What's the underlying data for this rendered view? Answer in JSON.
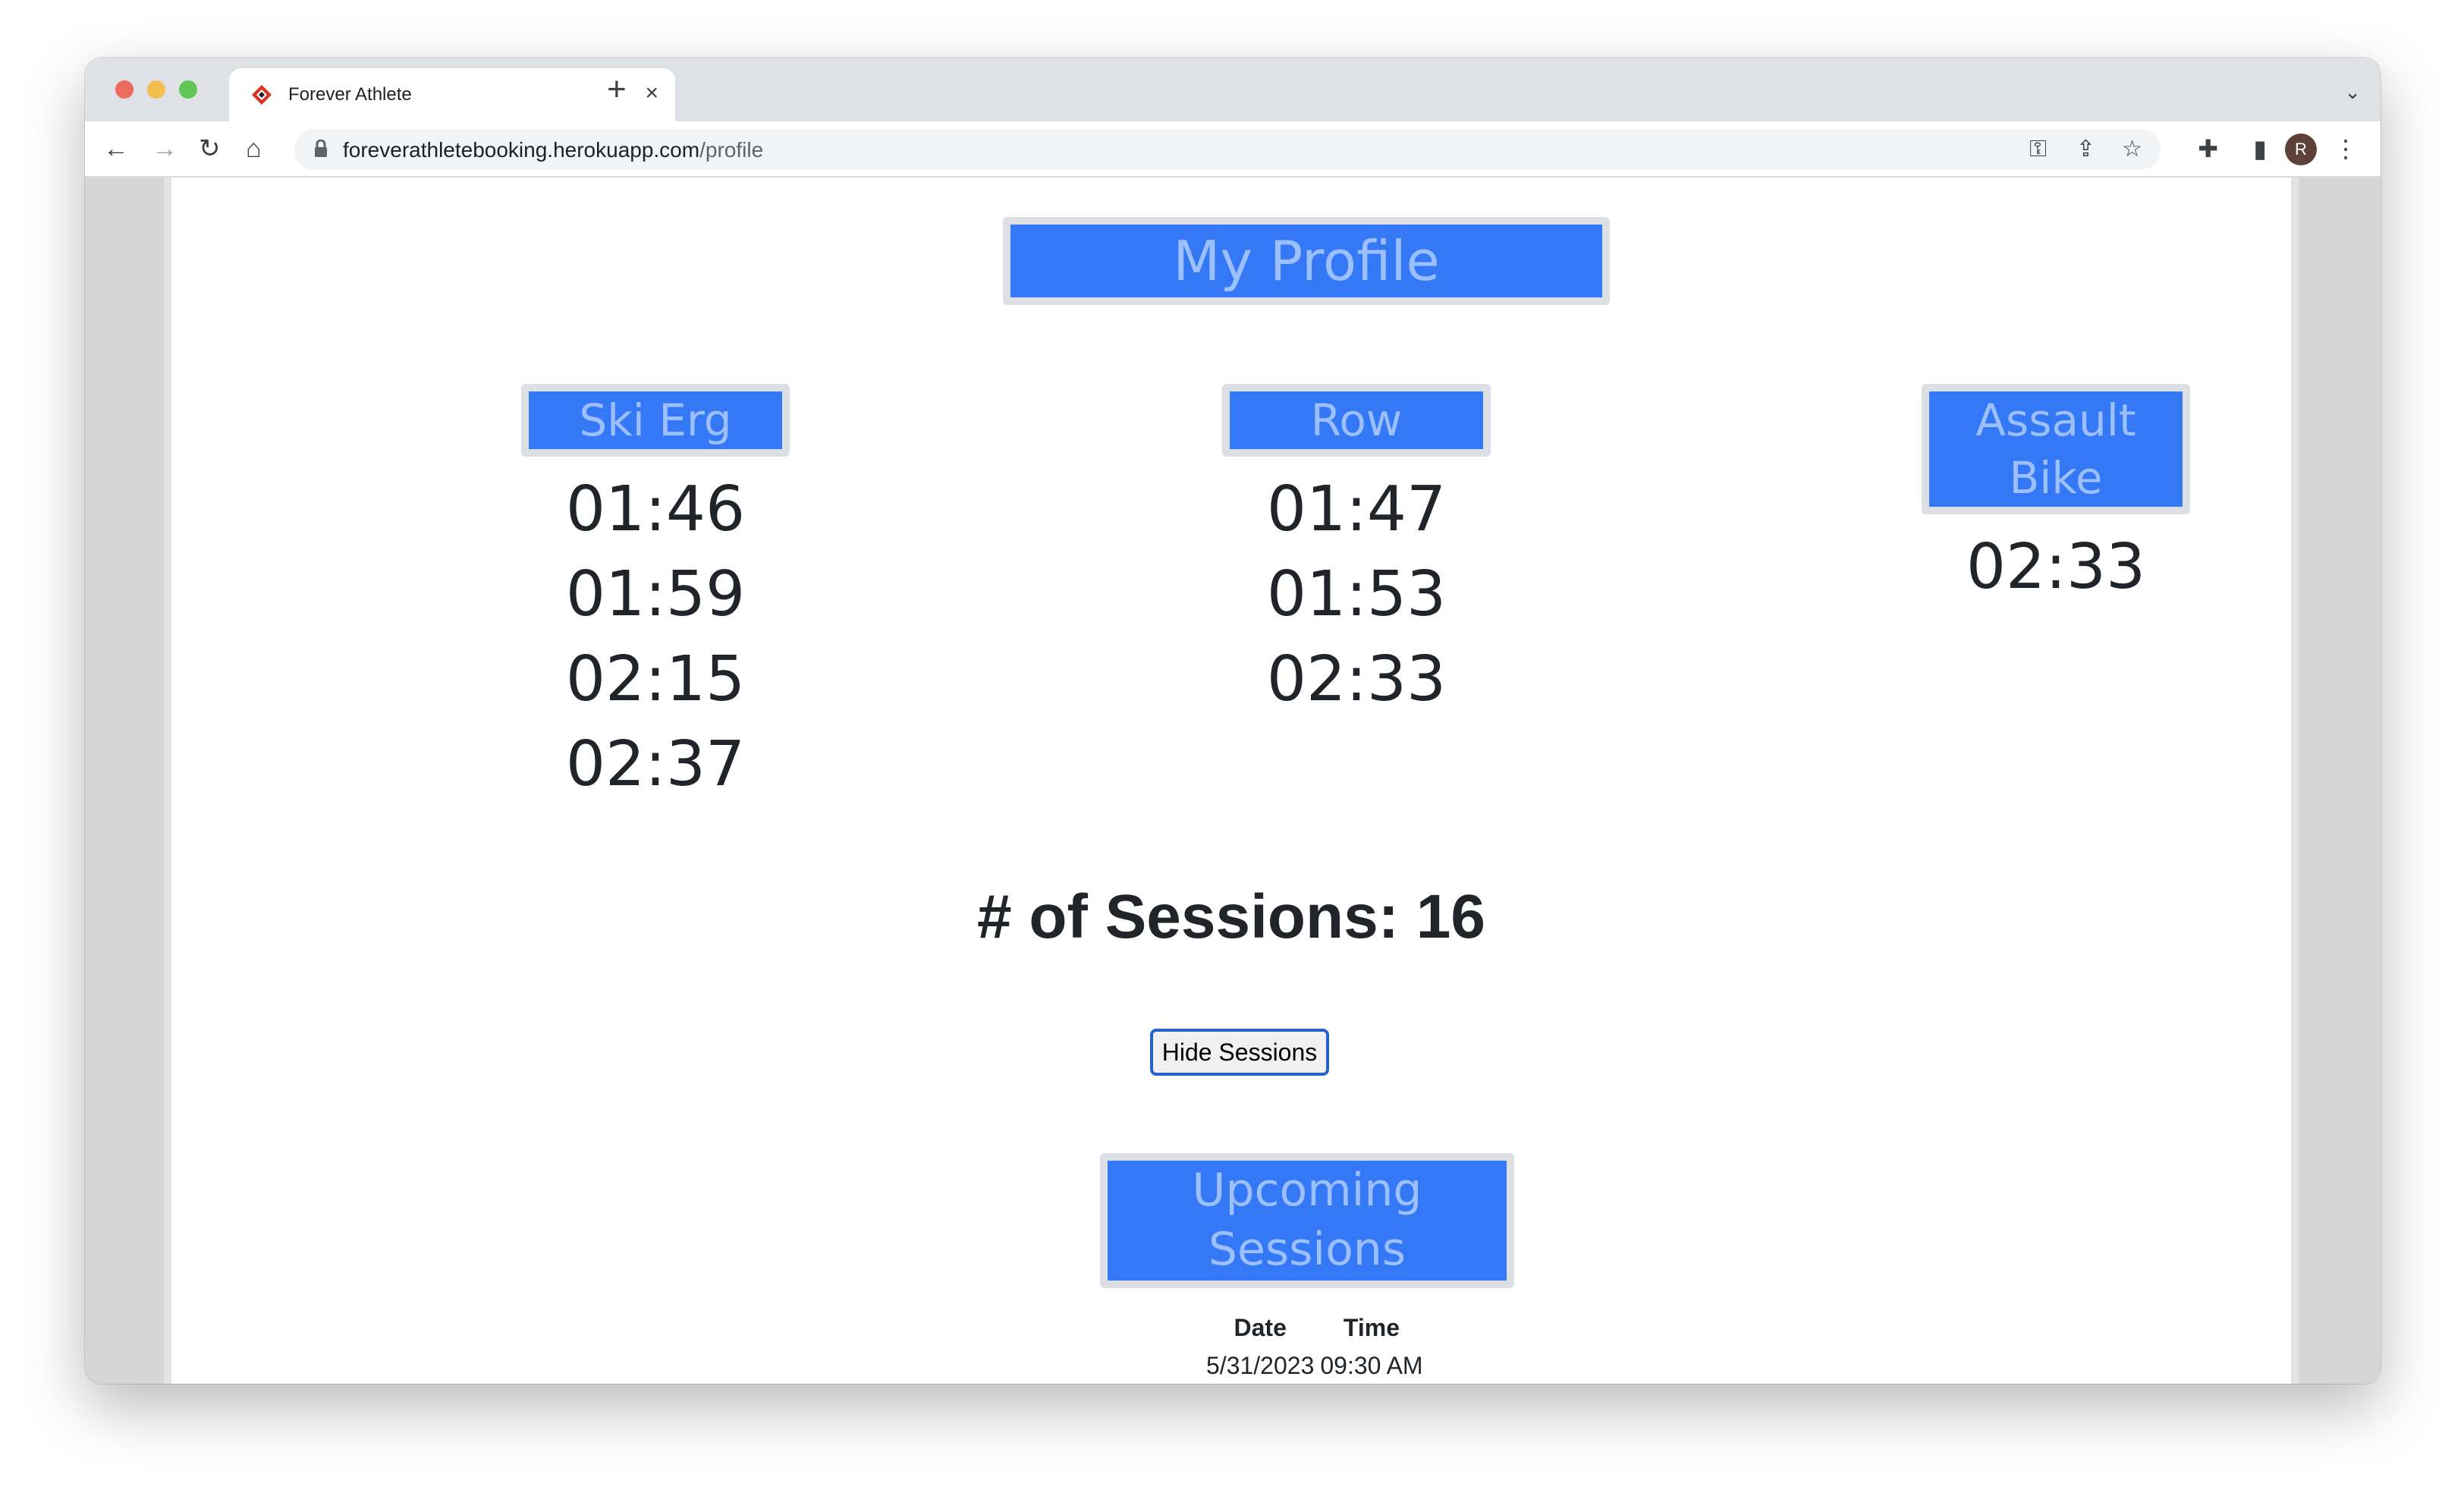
{
  "browser": {
    "tab_title": "Forever Athlete",
    "tab_close": "×",
    "new_tab": "+",
    "tab_menu": "⌄",
    "url_host": "foreverathletebooking.herokuapp.com",
    "url_path": "/profile",
    "avatar_letter": "R",
    "icons": {
      "back": "←",
      "forward": "→",
      "reload": "↻",
      "home": "⌂",
      "key": "⚿",
      "share": "⇪",
      "star": "☆",
      "extensions": "✚",
      "sidepanel": "▮",
      "menu": "⋮"
    }
  },
  "profile": {
    "title": "My Profile",
    "columns": [
      {
        "heading": "Ski Erg",
        "times": [
          "01:46",
          "01:59",
          "02:15",
          "02:37"
        ]
      },
      {
        "heading": "Row",
        "times": [
          "01:47",
          "01:53",
          "02:33"
        ]
      },
      {
        "heading": "Assault Bike",
        "times": [
          "02:33"
        ]
      }
    ],
    "sessions_count_label": "# of Sessions: 16",
    "hide_button_label": "Hide Sessions",
    "upcoming_title": "Upcoming Sessions",
    "table": {
      "headers": [
        "Date",
        "Time"
      ],
      "rows": [
        [
          "5/31/2023",
          "09:30 AM"
        ]
      ]
    }
  },
  "colors": {
    "accent_blue": "#3478f6",
    "accent_text": "#9cc0ff",
    "box_border": "#dcdfe3"
  }
}
